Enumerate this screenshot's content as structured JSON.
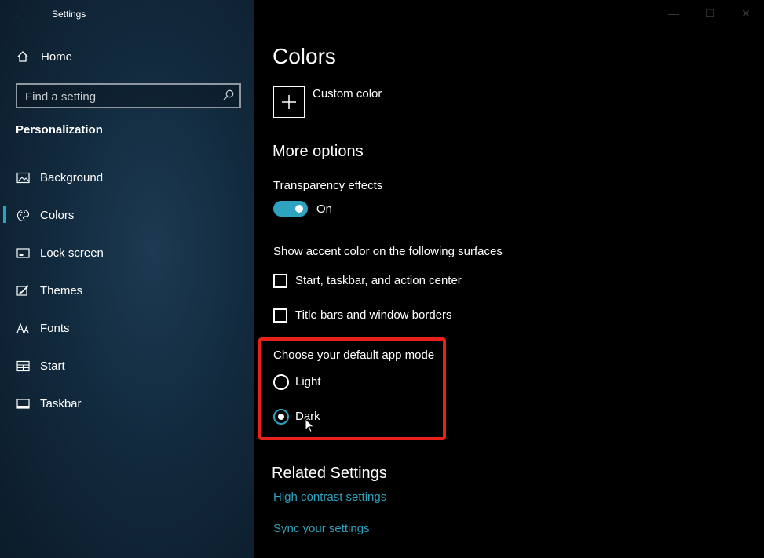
{
  "window": {
    "title": "Settings",
    "controls": [
      "—",
      "☐",
      "✕"
    ]
  },
  "sidebar": {
    "home_label": "Home",
    "search_placeholder": "Find a setting",
    "section": "Personalization",
    "items": [
      {
        "label": "Background",
        "icon": "picture-icon"
      },
      {
        "label": "Colors",
        "icon": "palette-icon",
        "active": true
      },
      {
        "label": "Lock screen",
        "icon": "lock-screen-icon"
      },
      {
        "label": "Themes",
        "icon": "themes-brush-icon"
      },
      {
        "label": "Fonts",
        "icon": "font-icon"
      },
      {
        "label": "Start",
        "icon": "start-grid-icon"
      },
      {
        "label": "Taskbar",
        "icon": "taskbar-icon"
      }
    ]
  },
  "main": {
    "title": "Colors",
    "custom_color_label": "Custom color",
    "more_options": "More options",
    "transparency_label": "Transparency effects",
    "transparency_state": "On",
    "accent_surfaces_label": "Show accent color on the following surfaces",
    "checkboxes": [
      {
        "label": "Start, taskbar, and action center",
        "checked": false
      },
      {
        "label": "Title bars and window borders",
        "checked": false
      }
    ],
    "app_mode_label": "Choose your default app mode",
    "app_modes": [
      {
        "label": "Light",
        "selected": false
      },
      {
        "label": "Dark",
        "selected": true
      }
    ],
    "related_title": "Related Settings",
    "links": [
      "High contrast settings",
      "Sync your settings"
    ]
  },
  "colors": {
    "accent": "#2ea3bf",
    "highlight_border": "#e8201a",
    "sidebar_bg": "#122a3e",
    "content_bg": "#000000"
  }
}
